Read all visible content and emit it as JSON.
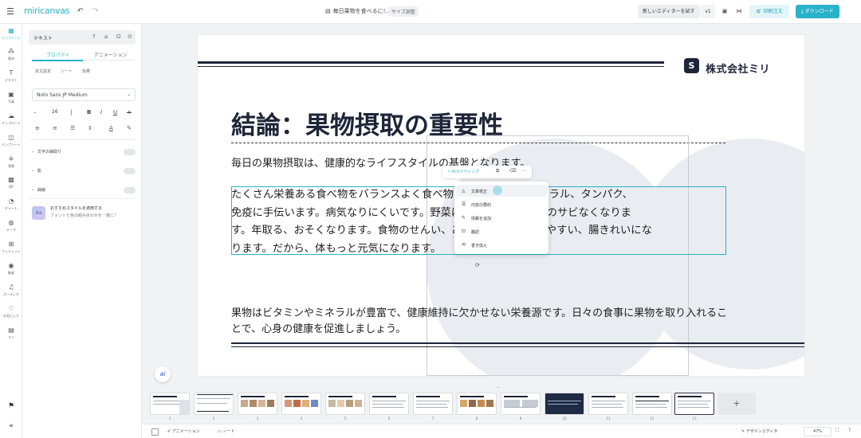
{
  "topbar": {
    "menu_icon": "☰",
    "logo": "miricanvas",
    "undo_icon": "↶",
    "redo_icon": "↷",
    "doc_title": "毎日果物を食べるに!...",
    "size_label": "サイズ調整",
    "new_editor": "新しいエディターを試す",
    "version": "v1",
    "buy_label": "印刷注文",
    "download_label": "ダウンロード"
  },
  "rail": {
    "items": [
      {
        "icon": "template-icon",
        "label": "テンプレート"
      },
      {
        "icon": "element-icon",
        "label": "素材"
      },
      {
        "icon": "text-icon",
        "label": "テキスト"
      },
      {
        "icon": "photo-icon",
        "label": "写真"
      },
      {
        "icon": "upload-icon",
        "label": "アップロード"
      },
      {
        "icon": "mytemplate-icon",
        "label": "テンプレート"
      },
      {
        "icon": "background-icon",
        "label": "背景"
      },
      {
        "icon": "qr-icon",
        "label": "QR"
      },
      {
        "icon": "chart-icon",
        "label": "チャート"
      },
      {
        "icon": "palette-icon",
        "label": "テーマ"
      },
      {
        "icon": "widget-icon",
        "label": "ウィジェット"
      },
      {
        "icon": "video-icon",
        "label": "動画"
      },
      {
        "icon": "music-icon",
        "label": "オーディオ"
      },
      {
        "icon": "heart-icon",
        "label": "お気に入り"
      },
      {
        "icon": "folder-icon",
        "label": "マイ"
      }
    ]
  },
  "panel": {
    "type_label": "テキスト",
    "tabs": [
      "プロパティ",
      "アニメーション"
    ],
    "subtabs": [
      "本文設定",
      "シート",
      "効果"
    ],
    "font_name": "Noto Sans JP Medium",
    "font_size": "26",
    "sections": [
      "文字の縁取り",
      "影",
      "曲線"
    ],
    "promo_title": "おすすめスタイルを適用する",
    "promo_sub": "フォントと色の組み合わせを一度に！"
  },
  "slide": {
    "company": "株式会社ミリ",
    "title": "結論：果物摂取の重要性",
    "lead": "毎日の果物摂取は、健康的なライフスタイルの基盤となります。",
    "body_lines": [
      "たくさん栄養ある食べ物をバランスよく食べ物、ビタミンとかミネラル、タンパク、",
      "免疫に手伝います。病気なりにくいです。野菜は酸化ものある、体のサビなくなりま",
      "す。年取る、おそくなります。食物のせんい、あります。うんち出やすい、腸きれいにな",
      "ります。だから、体もっと元気になります。"
    ],
    "conclusion_lines": [
      "果物はビタミンやミネラルが豊富で、健康維持に欠かせない栄養源です。日々の食事に果物を取り入れるこ",
      "とで、心身の健康を促進しましょう。"
    ]
  },
  "floating_toolbar": {
    "ai_writing": "AIライティング"
  },
  "context_menu": {
    "items": [
      "文章校正",
      "内容の要約",
      "情報を追加",
      "翻訳",
      "書き換え"
    ]
  },
  "thumbnails": {
    "numbers": [
      "1",
      "2",
      "3",
      "4",
      "5",
      "6",
      "7",
      "8",
      "9",
      "10",
      "11",
      "12",
      "13"
    ],
    "add_label": "+"
  },
  "bottombar": {
    "animation": "アニメーション",
    "note": "ノート",
    "design_editor": "デザインエディタ",
    "zoom": "47%"
  },
  "colors": {
    "accent": "#29b3c8",
    "navy": "#1e2538",
    "circle": "#e9ecf0"
  }
}
